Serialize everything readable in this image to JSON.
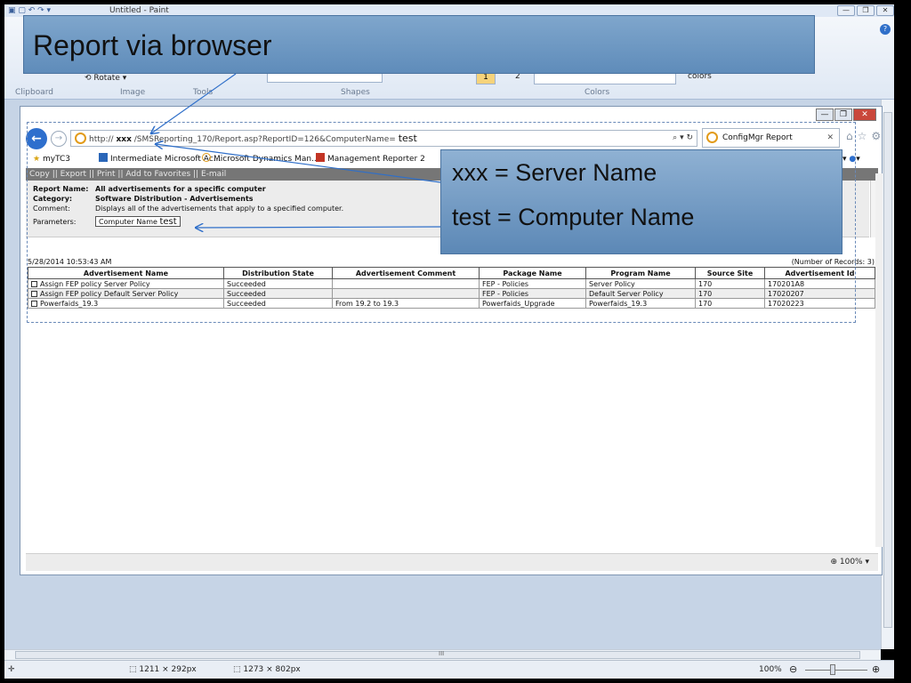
{
  "paint": {
    "window_title": "Untitled - Paint",
    "ribbon": {
      "rotate_label": "Rotate",
      "colors_label": "colors",
      "color1_label": "1",
      "color2_label": "2",
      "groups": [
        "Clipboard",
        "Image",
        "Tools",
        "Shapes",
        "Colors"
      ]
    },
    "status": {
      "selection_size": "1211 × 292px",
      "image_size": "1273 × 802px",
      "zoom": "100%"
    },
    "scroll_marker": "III"
  },
  "callouts": {
    "main": "Report via browser",
    "server": "xxx = Server Name",
    "computer": "test = Computer Name"
  },
  "browser": {
    "address": {
      "prefix": "http://",
      "server": "xxx",
      "path": "/SMSReporting_170/Report.asp?ReportID=126&ComputerName=",
      "computer": "test"
    },
    "tab_title": "ConfigMgr Report",
    "favorites": [
      "myTC3",
      "Intermediate Microsoft Ac...",
      "Microsoft Dynamics Man...",
      "Management Reporter 2"
    ],
    "report_menu": "Copy  ||  Export  ||  Print  ||  Add to Favorites  ||  E-mail",
    "report_info": {
      "name_label": "Report Name:",
      "name_value": "All advertisements for a specific computer",
      "category_label": "Category:",
      "category_value": "Software Distribution - Advertisements",
      "comment_label": "Comment:",
      "comment_value": "Displays all of the advertisements that apply to a specified computer.",
      "params_label": "Parameters:",
      "param_name": "Computer Name",
      "param_value": "test"
    },
    "results": {
      "timestamp": "5/28/2014 10:53:43 AM",
      "record_count": "(Number of Records: 3)",
      "columns": [
        "Advertisement Name",
        "Distribution State",
        "Advertisement Comment",
        "Package Name",
        "Program Name",
        "Source Site",
        "Advertisement Id"
      ],
      "rows": [
        [
          "Assign FEP policy Server Policy",
          "Succeeded",
          "",
          "FEP - Policies",
          "Server Policy",
          "170",
          "170201A8"
        ],
        [
          "Assign FEP policy Default Server Policy",
          "Succeeded",
          "",
          "FEP - Policies",
          "Default Server Policy",
          "170",
          "17020207"
        ],
        [
          "Powerfaids_19.3",
          "Succeeded",
          "From 19.2 to 19.3",
          "Powerfaids_Upgrade",
          "Powerfaids_19.3",
          "170",
          "17020223"
        ]
      ]
    },
    "zoom": "100%"
  }
}
